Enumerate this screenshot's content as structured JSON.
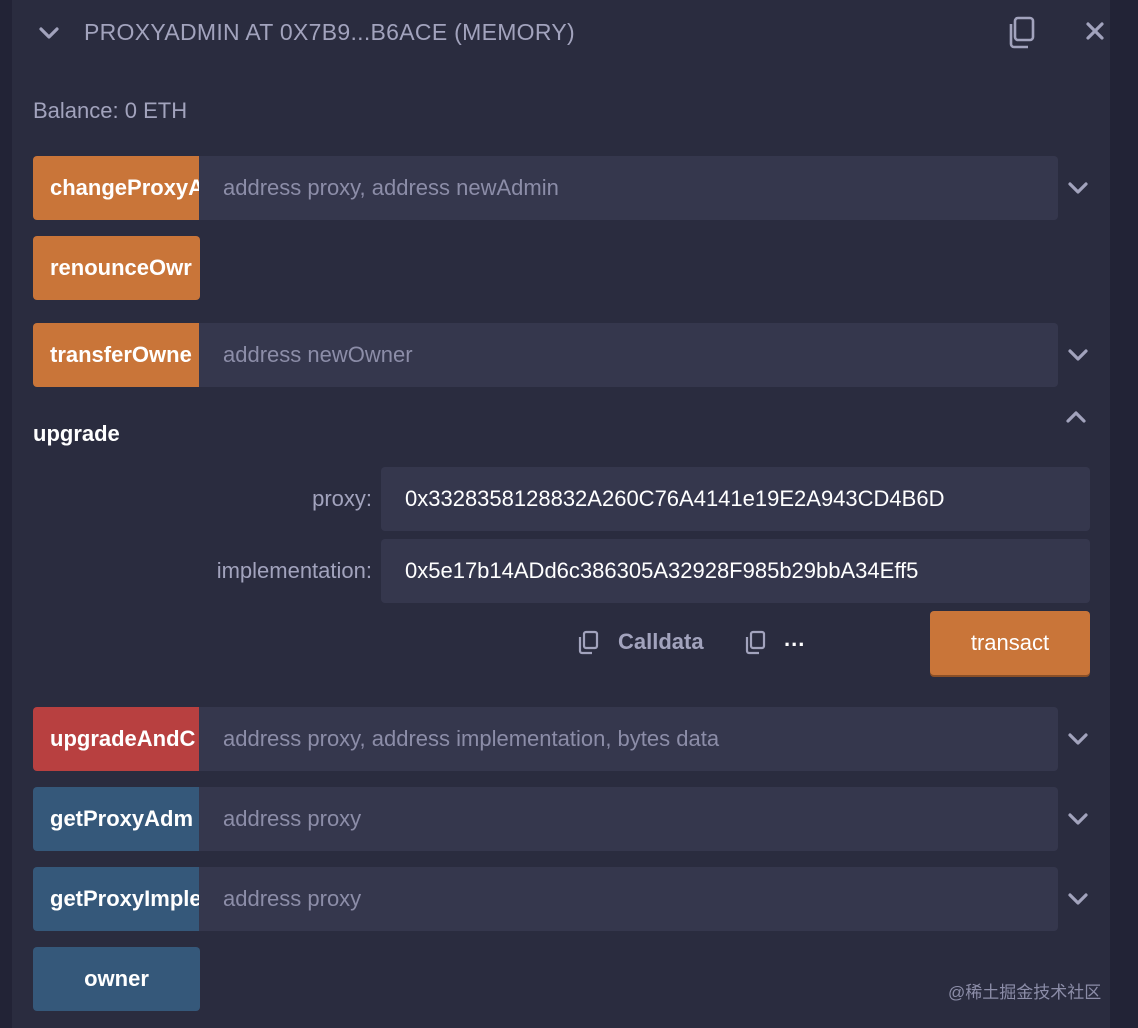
{
  "header": {
    "title": "PROXYADMIN AT 0X7B9...B6ACE (MEMORY)"
  },
  "balance": "Balance: 0 ETH",
  "functions": {
    "change_proxy_admin": {
      "label": "changeProxyA",
      "placeholder": "address proxy, address newAdmin"
    },
    "renounce_ownership": {
      "label": "renounceOwr"
    },
    "transfer_ownership": {
      "label": "transferOwne",
      "placeholder": "address newOwner"
    },
    "upgrade": {
      "title": "upgrade",
      "proxy_label": "proxy:",
      "proxy_value": "0x3328358128832A260C76A4141e19E2A943CD4B6D",
      "implementation_label": "implementation:",
      "implementation_value": "0x5e17b14ADd6c386305A32928F985b29bbA34Eff5",
      "calldata_label": "Calldata",
      "more_label": "...",
      "transact_label": "transact"
    },
    "upgrade_and_call": {
      "label": "upgradeAndC",
      "placeholder": "address proxy, address implementation, bytes data"
    },
    "get_proxy_admin": {
      "label": "getProxyAdm",
      "placeholder": "address proxy"
    },
    "get_proxy_implementation": {
      "label": "getProxyImple",
      "placeholder": "address proxy"
    },
    "owner": {
      "label": "owner"
    }
  },
  "watermark": "@稀土掘金技术社区",
  "colors": {
    "background": "#2a2c3f",
    "input": "#35374d",
    "payable_orange": "#c97539",
    "red": "#b84040",
    "view_blue": "#35587a"
  },
  "icons": {
    "collapse": "chevron-down-icon",
    "copy": "copy-icon",
    "close": "close-icon",
    "expand": "chevron-down-icon",
    "collapse_section": "chevron-up-icon"
  }
}
